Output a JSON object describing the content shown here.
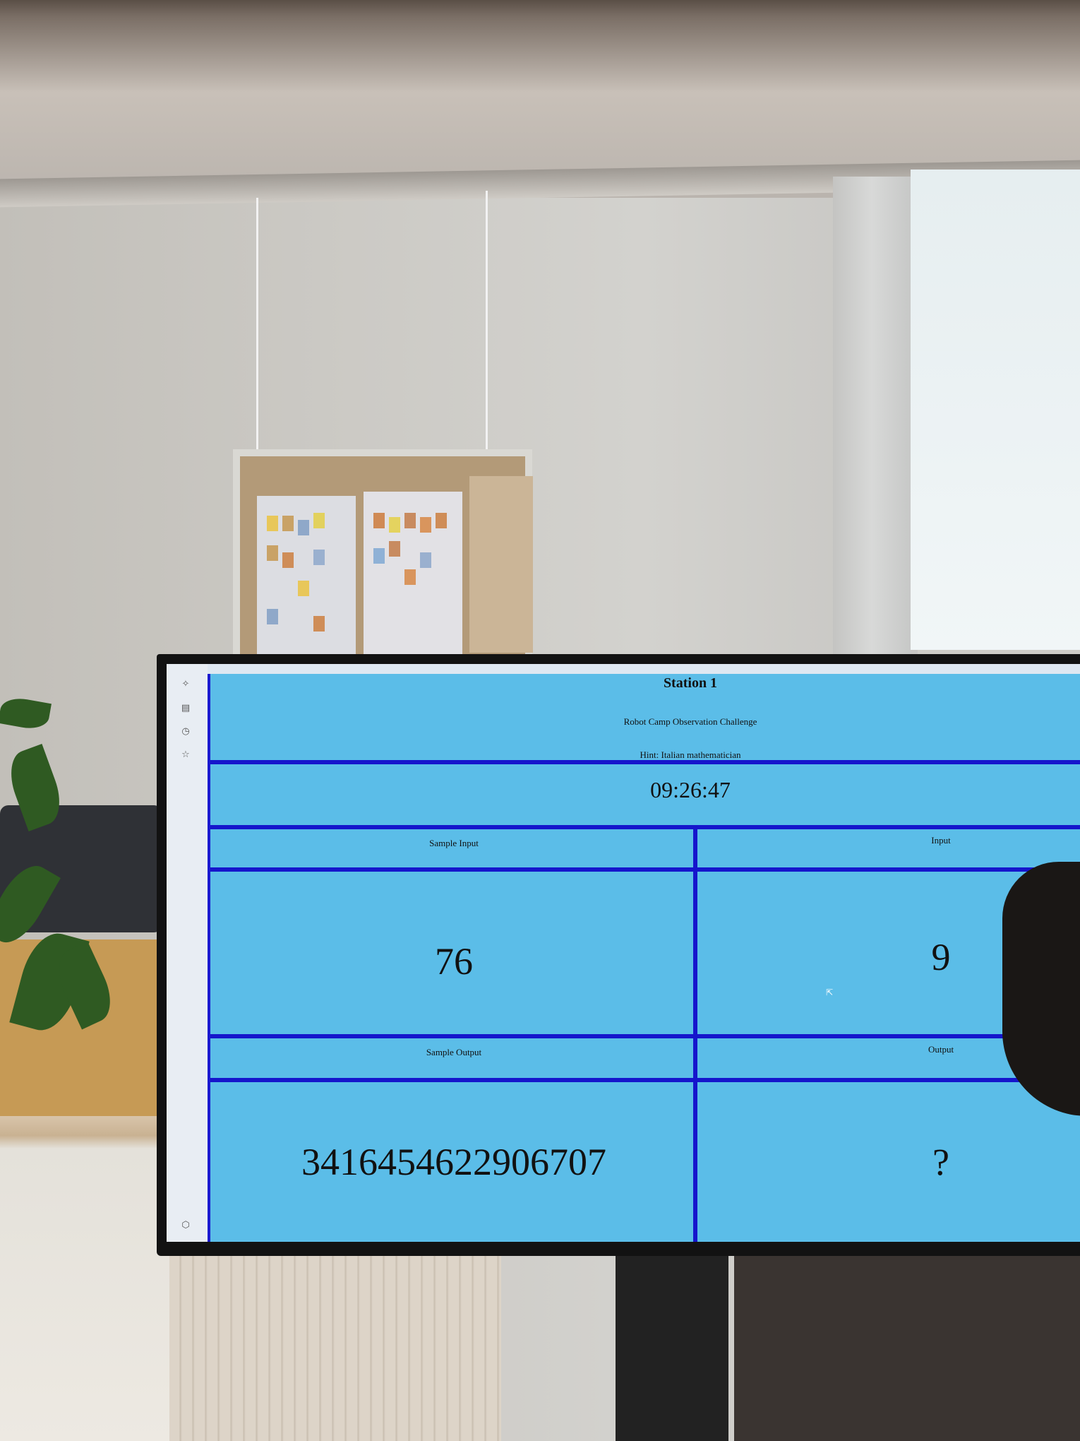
{
  "page": {
    "title": "Station 1",
    "subtitle": "Robot Camp Observation Challenge",
    "hint": "Hint: Italian mathematician",
    "clock": "09:26:47"
  },
  "panels": {
    "sample_input": {
      "label": "Sample Input",
      "value": "76"
    },
    "input": {
      "label": "Input",
      "value": "9"
    },
    "sample_output": {
      "label": "Sample Output",
      "value": "3416454622906707"
    },
    "output": {
      "label": "Output",
      "value": "?"
    }
  },
  "sidebar": {
    "icons": [
      "settings-icon",
      "save-icon",
      "history-icon",
      "star-icon",
      "extension-icon"
    ]
  },
  "colors": {
    "page_background": "#5bbde8",
    "divider": "#1515cc"
  }
}
